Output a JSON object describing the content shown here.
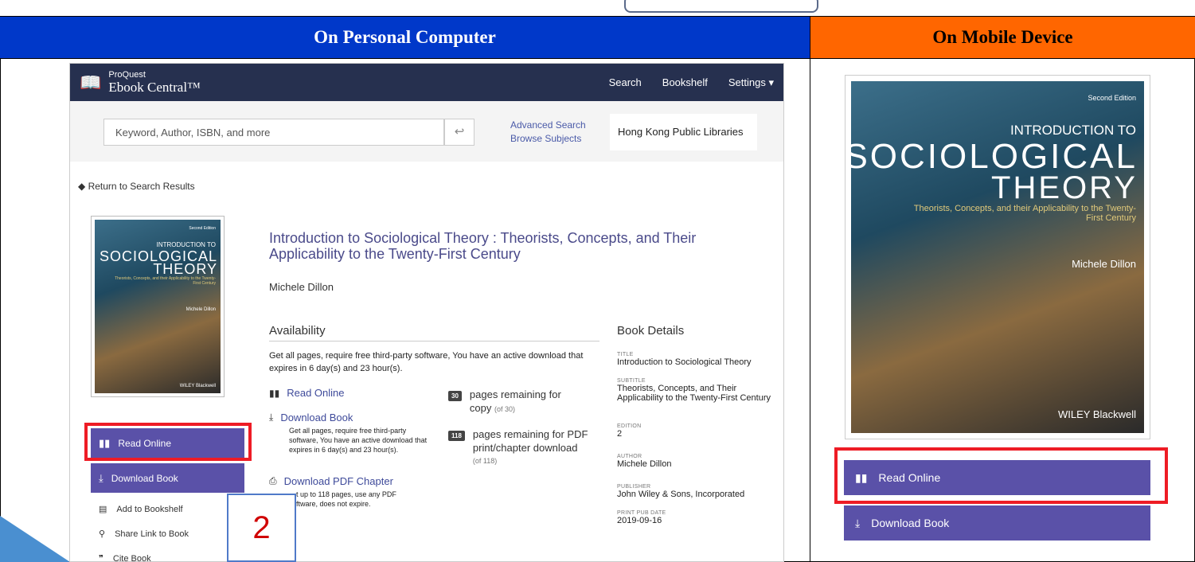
{
  "headers": {
    "pc": "On Personal Computer",
    "mobile": "On Mobile Device"
  },
  "pc": {
    "nav": {
      "brand_small": "ProQuest",
      "brand_big": "Ebook Central™",
      "search": "Search",
      "bookshelf": "Bookshelf",
      "settings": "Settings ▾"
    },
    "search": {
      "placeholder": "Keyword, Author, ISBN, and more",
      "go": "↩",
      "advanced": "Advanced Search",
      "browse": "Browse Subjects",
      "library": "Hong Kong Public Libraries"
    },
    "return": "Return to Search Results",
    "cover": {
      "edition": "Second Edition",
      "t1": "INTRODUCTION TO",
      "t2": "SOCIOLOGICAL",
      "t3": "THEORY",
      "t4": "Theorists, Concepts, and their Applicability to the Twenty-First Century",
      "author": "Michele Dillon",
      "publisher": "WILEY Blackwell"
    },
    "buttons": {
      "read_online": "Read Online",
      "download_book": "Download Book"
    },
    "side_links": {
      "add_bookshelf": "Add to Bookshelf",
      "share_link": "Share Link to Book",
      "cite": "Cite Book"
    },
    "book_title": "Introduction to Sociological Theory : Theorists, Concepts, and Their Applicability to the Twenty-First Century",
    "book_author": "Michele Dillon",
    "availability": {
      "heading": "Availability",
      "text": "Get all pages, require free third-party software, You have an active download that expires in 6 day(s) and 23 hour(s).",
      "read_online": "Read Online",
      "download_book": "Download Book",
      "download_text": "Get all pages, require free third-party software, You have an active download that expires in 6 day(s) and 23 hour(s).",
      "download_pdf": "Download PDF Chapter",
      "pdf_text_1": "…t up to 118 pages, use any PDF",
      "pdf_text_2": "…ftware, does not expire.",
      "copy_badge": "30",
      "copy_text_1": "pages remaining for",
      "copy_text_2": "copy",
      "copy_of": "(of 30)",
      "pdf_badge": "118",
      "pdf_text_a": "pages remaining for PDF",
      "pdf_text_b": "print/chapter download",
      "pdf_of": "(of 118)"
    },
    "details": {
      "heading": "Book Details",
      "title_k": "TITLE",
      "title_v": "Introduction to Sociological Theory",
      "subtitle_k": "SUBTITLE",
      "subtitle_v": "Theorists, Concepts, and Their Applicability to the Twenty-First Century",
      "edition_k": "EDITION",
      "edition_v": "2",
      "author_k": "AUTHOR",
      "author_v": "Michele Dillon",
      "publisher_k": "PUBLISHER",
      "publisher_v": "John Wiley & Sons, Incorporated",
      "date_k": "PRINT PUB DATE",
      "date_v": "2019-09-16"
    }
  },
  "step_number": "2",
  "mobile": {
    "buttons": {
      "read_online": "Read Online",
      "download_book": "Download Book"
    }
  },
  "colors": {
    "pc_header": "#0038c9",
    "mobile_header": "#ff6600",
    "button": "#5a51a8",
    "highlight": "#ee1c25",
    "nav": "#26304f"
  }
}
